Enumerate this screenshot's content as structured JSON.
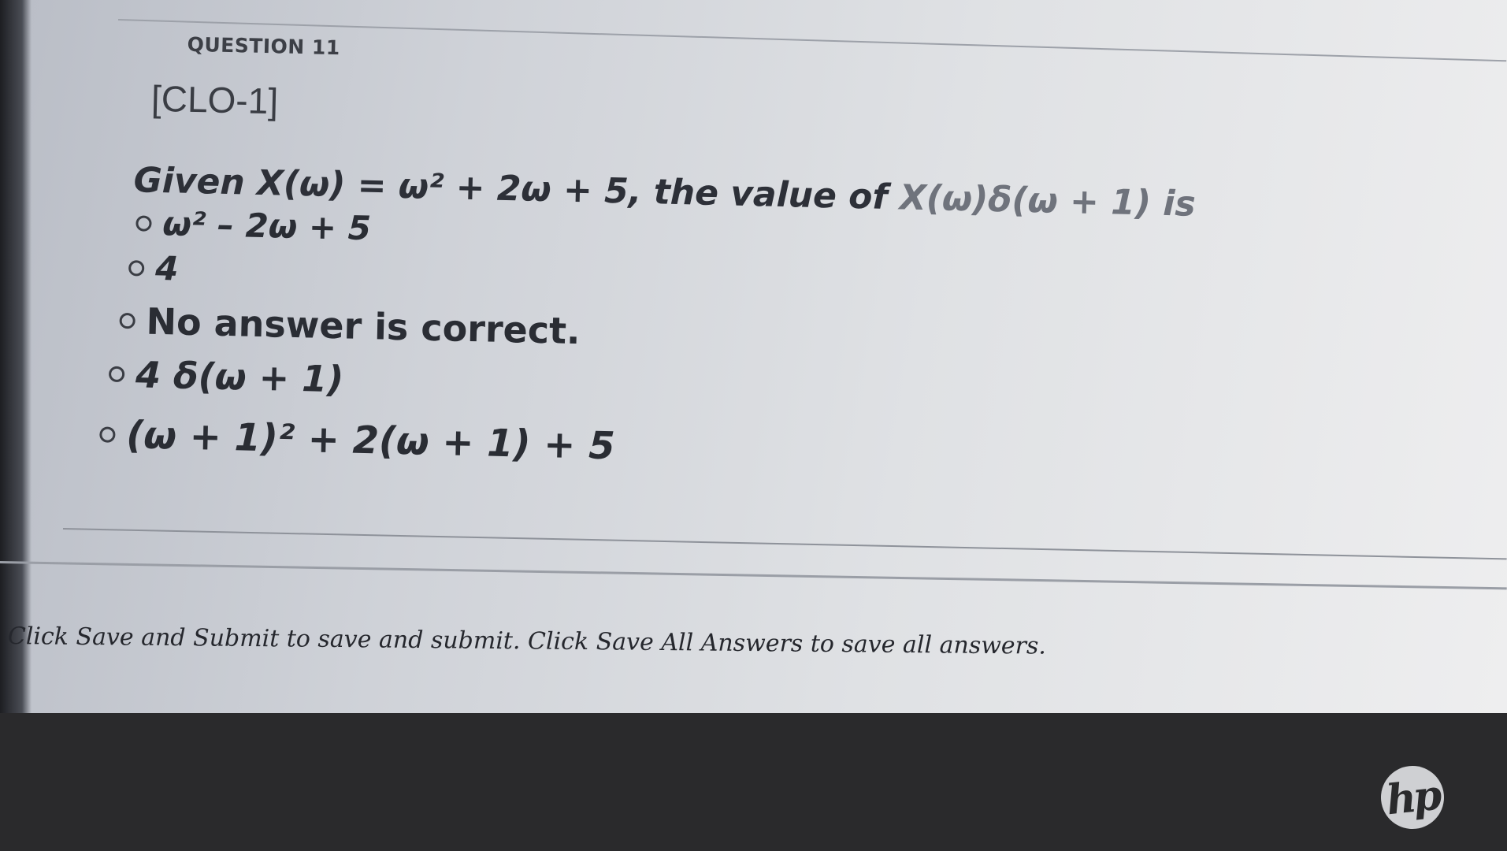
{
  "question": {
    "number_label": "QUESTION 11",
    "clo_tag": "[CLO-1]",
    "prompt_main": "Given X(ω) = ω² + 2ω + 5, the value of ",
    "prompt_tail": "X(ω)δ(ω + 1) is",
    "options": [
      {
        "label": "ω² – 2ω + 5",
        "selected": false
      },
      {
        "label": "4",
        "selected": false
      },
      {
        "label": "No answer is correct.",
        "selected": false
      },
      {
        "label": "4 δ(ω + 1)",
        "selected": false
      },
      {
        "label": "(ω + 1)² + 2(ω + 1) + 5",
        "selected": false
      }
    ]
  },
  "footer": {
    "instructions": "Click Save and Submit to save and submit. Click Save All Answers to save all answers."
  },
  "bezel": {
    "logo_text": "hp"
  },
  "colors": {
    "screen_bg": "#dfe1e4",
    "text": "#2a2d34",
    "bezel": "#2a2a2c"
  }
}
